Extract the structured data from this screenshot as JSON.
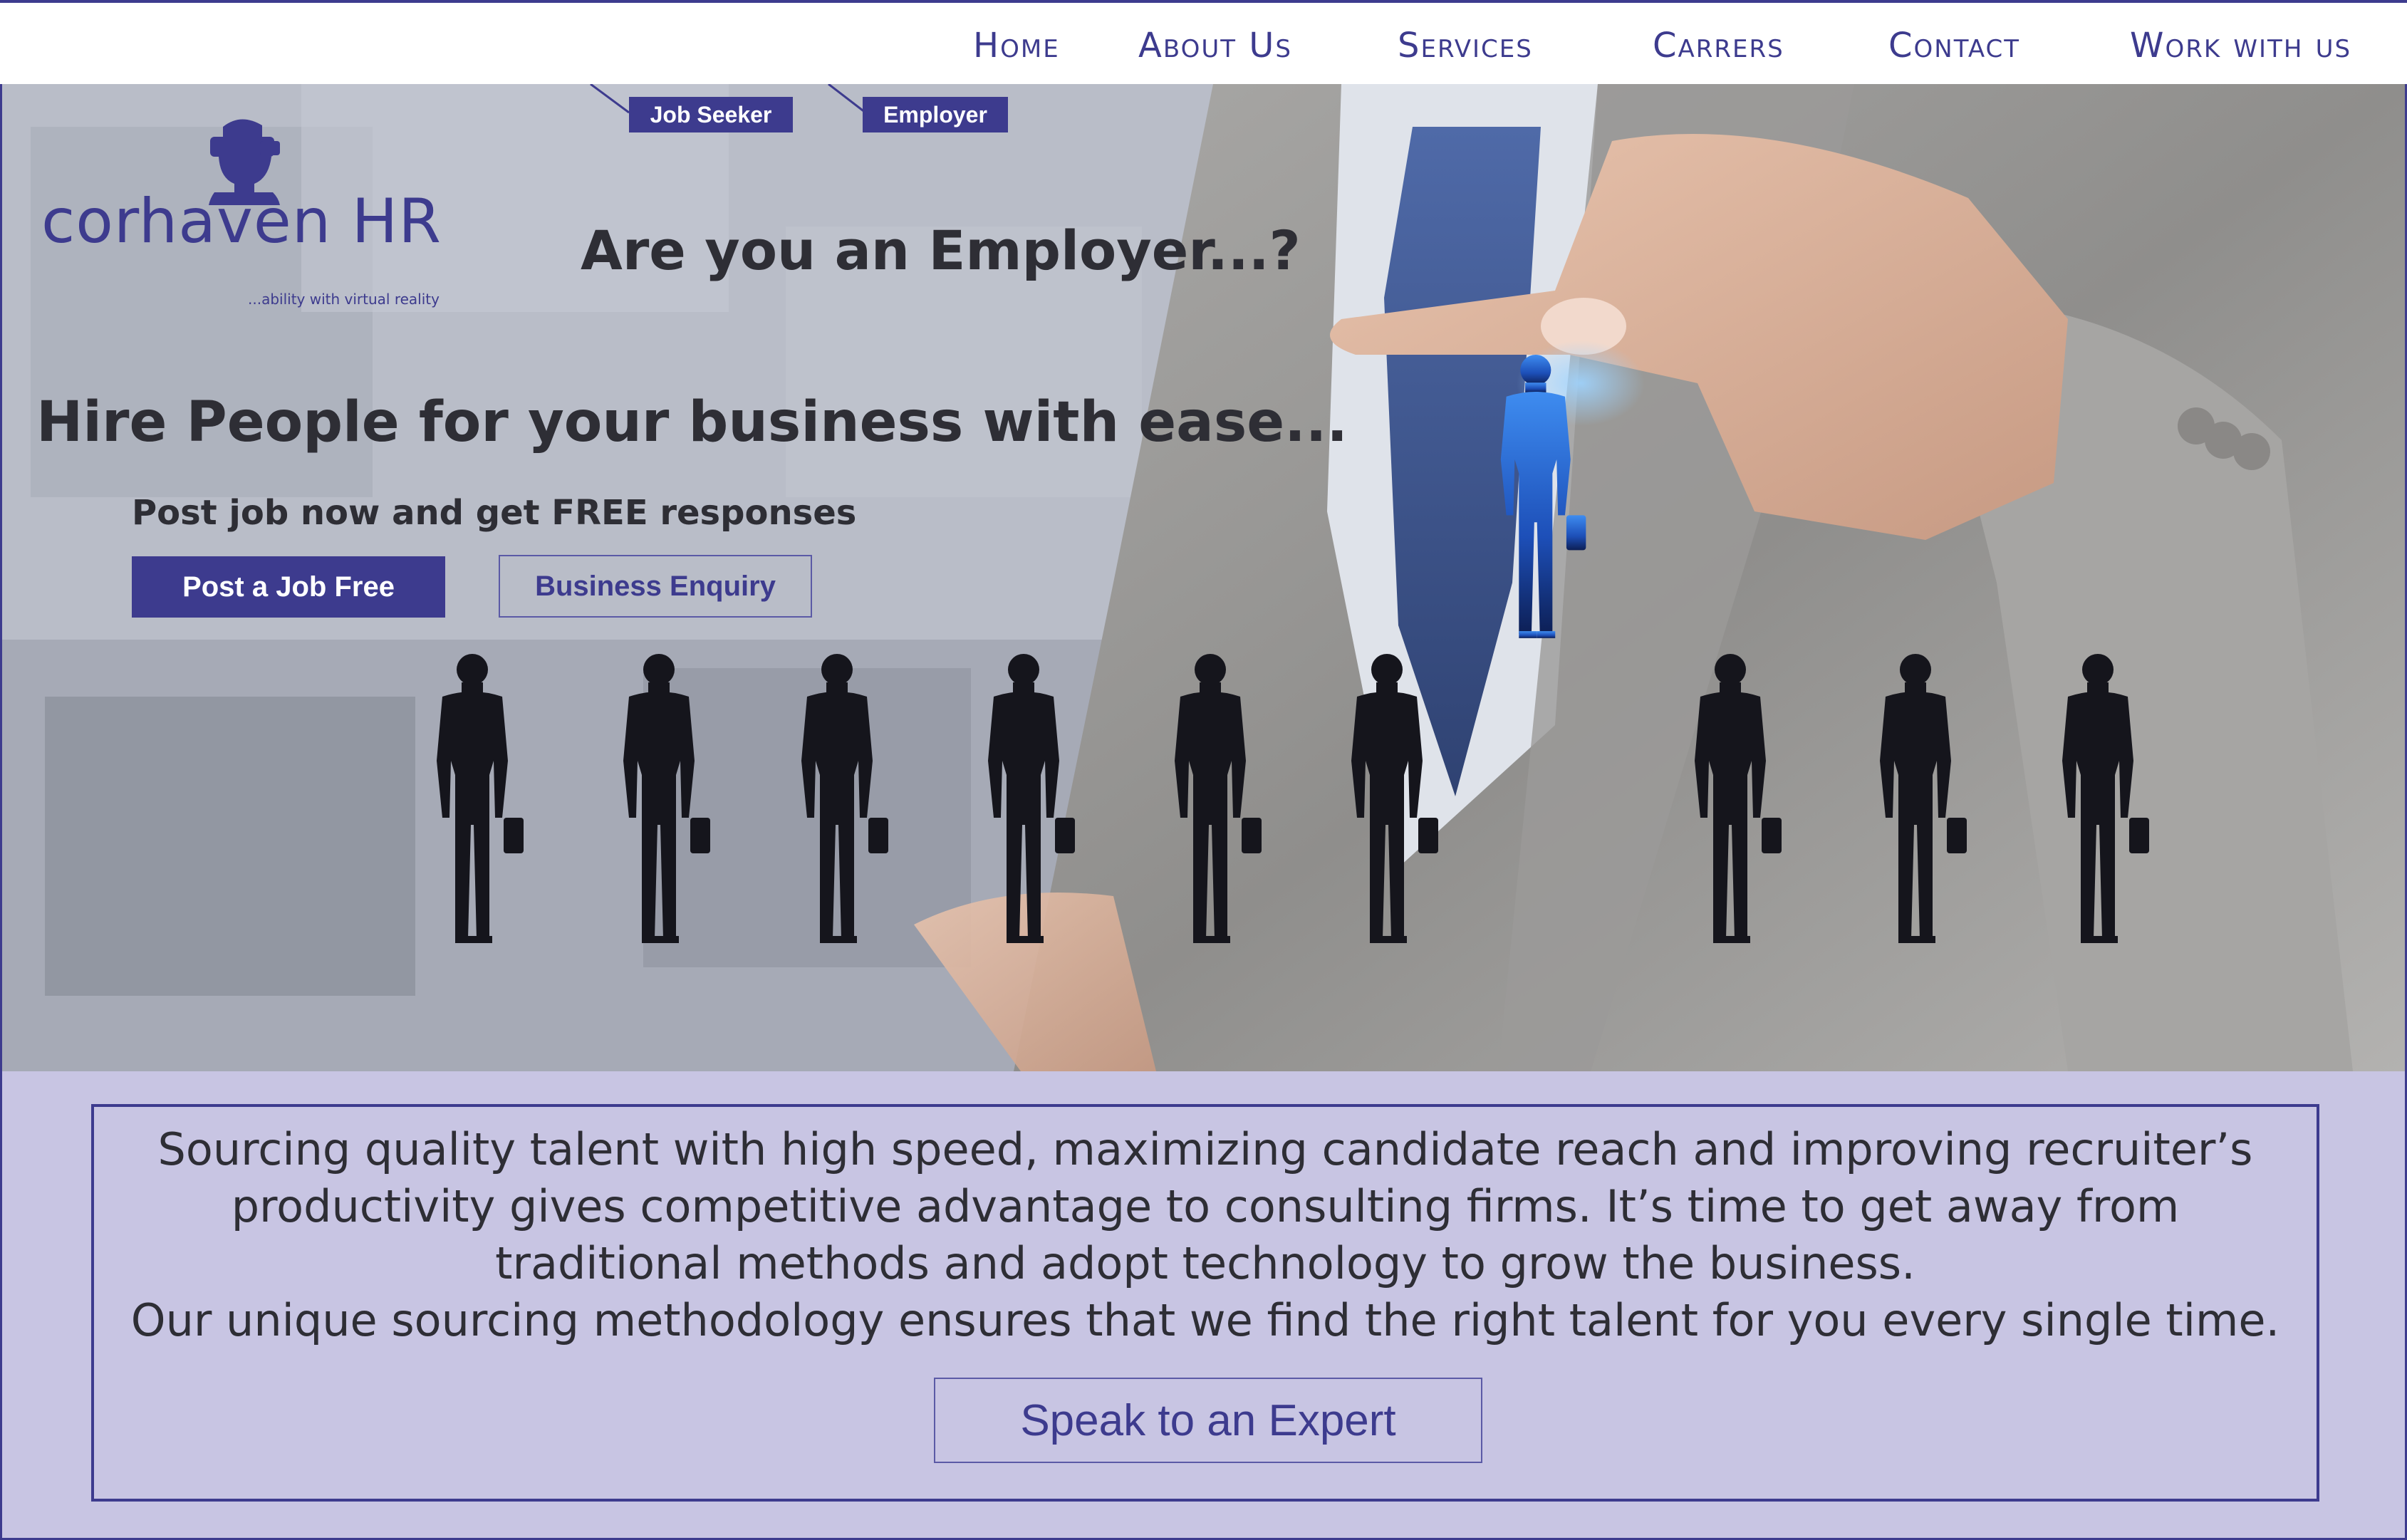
{
  "nav": {
    "items": [
      {
        "label": "Home"
      },
      {
        "label": "About Us"
      },
      {
        "label": "Services"
      },
      {
        "label": "Carrers"
      },
      {
        "label": "Contact"
      },
      {
        "label": "Work with us"
      }
    ]
  },
  "brand": {
    "name": "corhaven HR",
    "tagline": "...ability with virtual reality"
  },
  "audience_tabs": {
    "job_seeker": "Job Seeker",
    "employer": "Employer"
  },
  "hero": {
    "question": "Are you an Employer...?",
    "headline": "Hire People for your business with ease...",
    "subheadline": "Post job now and get FREE responses",
    "primary_button": "Post a Job Free",
    "secondary_button": "Business Enquiry"
  },
  "info": {
    "paragraph1": "Sourcing quality talent with high speed, maximizing candidate reach and improving recruiter’s productivity gives competitive advantage to consulting firms. It’s time to get away from traditional methods and adopt technology to grow the business.",
    "paragraph2": "Our unique sourcing methodology ensures that we find the right talent for you every single time.",
    "cta_button": "Speak to an Expert"
  },
  "colors": {
    "brand": "#3d3b8e",
    "info_background": "#c8c5e3",
    "headline_text": "#2e2e35"
  },
  "icons": {
    "logo": "vr-headset-person-icon",
    "people": "businessman-silhouette-icon",
    "selected_person": "highlighted-candidate-icon"
  }
}
